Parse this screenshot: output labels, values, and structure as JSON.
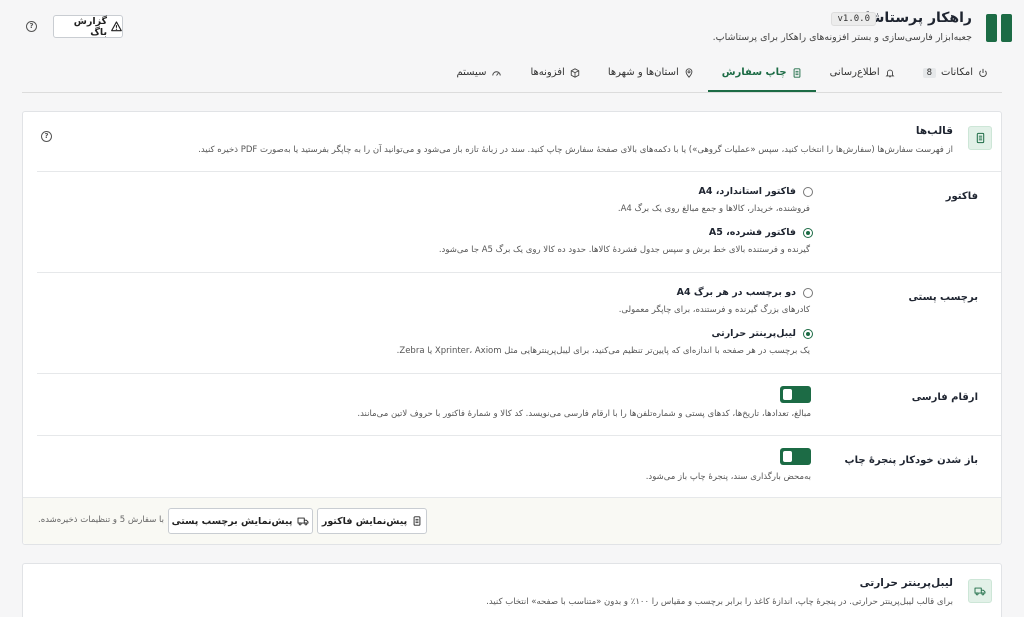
{
  "header": {
    "title": "راهکار پرستاشاپ",
    "version": "v1.0.0",
    "tagline": "جعبه‌ابزار فارسی‌سازی و بستر افزونه‌های راهکار برای پرستاشاپ.",
    "report_bug": "گزارش باگ"
  },
  "tabs": [
    {
      "label": "امکانات",
      "count": "8",
      "icon": "power-icon"
    },
    {
      "label": "اطلاع‌رسانی",
      "icon": "bell-icon"
    },
    {
      "label": "چاپ سفارش",
      "icon": "document-icon",
      "active": true
    },
    {
      "label": "استان‌ها و شهرها",
      "icon": "location-icon"
    },
    {
      "label": "افزونه‌ها",
      "icon": "box-icon"
    },
    {
      "label": "سیستم",
      "icon": "gauge-icon"
    }
  ],
  "templates": {
    "title": "قالب‌ها",
    "description": "از فهرست سفارش‌ها (سفارش‌ها را انتخاب کنید، سپس «عملیات گروهی») یا با دکمه‌های بالای صفحهٔ سفارش چاپ کنید. سند در زبانهٔ تازه باز می‌شود و می‌توانید آن را به چاپگر بفرستید یا به‌صورت PDF ذخیره کنید.",
    "invoice": {
      "label": "فاکتور",
      "options": [
        {
          "title": "فاکتور استاندارد، A4",
          "desc": "فروشنده، خریدار، کالاها و جمع مبالغ روی یک برگ A4.",
          "selected": false
        },
        {
          "title": "فاکتور فشرده، A5",
          "desc": "گیرنده و فرستنده بالای خط برش و سپس جدول فشردهٔ کالاها. حدود ده کالا روی یک برگ A5 جا می‌شود.",
          "selected": true
        }
      ]
    },
    "postal_label": {
      "label": "برچسب پستی",
      "options": [
        {
          "title": "دو برچسب در هر برگ A4",
          "desc": "کادرهای بزرگ گیرنده و فرستنده، برای چاپگر معمولی.",
          "selected": false
        },
        {
          "title": "لیبل‌پرینتر حرارتی",
          "desc": "یک برچسب در هر صفحه با اندازه‌ای که پایین‌تر تنظیم می‌کنید، برای لیبل‌پرینترهایی مثل Xprinter، Axiom یا Zebra.",
          "selected": true
        }
      ]
    },
    "persian_digits": {
      "label": "ارقام فارسی",
      "enabled": true,
      "desc": "مبالغ، تعدادها، تاریخ‌ها، کدهای پستی و شماره‌تلفن‌ها را با ارقام فارسی می‌نویسد. کد کالا و شمارهٔ فاکتور با حروف لاتین می‌مانند."
    },
    "auto_print": {
      "label": "باز شدن خودکار پنجرهٔ چاپ",
      "enabled": true,
      "desc": "به‌محض بارگذاری سند، پنجرهٔ چاپ باز می‌شود."
    },
    "footer": {
      "preview_invoice": "پیش‌نمایش فاکتور",
      "preview_label": "پیش‌نمایش برچسب پستی",
      "note": "با سفارش 5 و تنظیمات ذخیره‌شده."
    }
  },
  "thermal": {
    "title": "لیبل‌پرینتر حرارتی",
    "description": "برای قالب لیبل‌پرینتر حرارتی. در پنجرهٔ چاپ، اندازهٔ کاغذ را برابر برچسب و مقیاس را ۱۰۰٪ و بدون «متناسب با صفحه» انتخاب کنید."
  },
  "colors": {
    "accent": "#1c6b45",
    "accent_light": "#e2f1e8"
  }
}
